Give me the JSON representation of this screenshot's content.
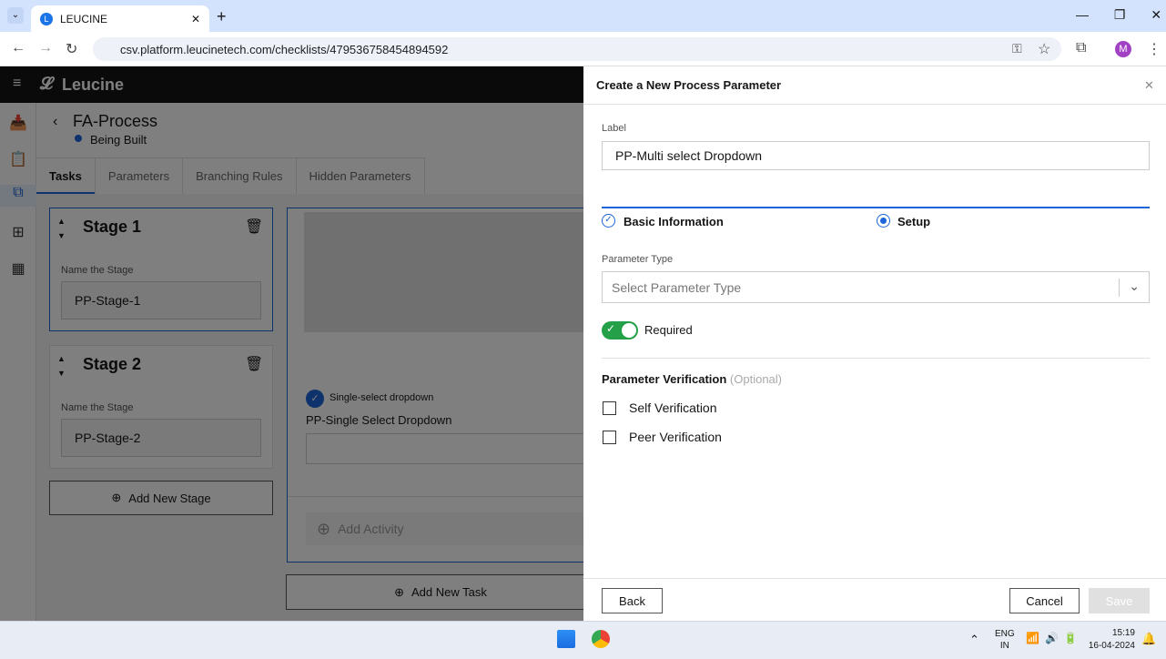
{
  "browser": {
    "tab_title": "LEUCINE",
    "url": "csv.platform.leucinetech.com/checklists/479536758454894592",
    "profile_initial": "M"
  },
  "app": {
    "brand": "Leucine",
    "process_title": "FA-Process",
    "status": "Being Built",
    "status_color": "#1d64d8",
    "tabs": [
      "Tasks",
      "Parameters",
      "Branching Rules",
      "Hidden Parameters"
    ],
    "stages": [
      {
        "title": "Stage 1",
        "name_label": "Name the Stage",
        "value": "PP-Stage-1"
      },
      {
        "title": "Stage 2",
        "name_label": "Name the Stage",
        "value": "PP-Stage-2"
      }
    ],
    "add_stage": "Add New Stage",
    "task": {
      "param_type": "Single-select dropdown",
      "param_label": "PP-Single Select Dropdown",
      "add_activity": "Add Activity",
      "add_task": "Add New Task"
    }
  },
  "panel": {
    "title": "Create a New Process Parameter",
    "label_caption": "Label",
    "label_value": "PP-Multi select Dropdown",
    "steps": [
      "Basic Information",
      "Setup"
    ],
    "param_type_caption": "Parameter Type",
    "param_type_placeholder": "Select Parameter Type",
    "required_label": "Required",
    "required_on": true,
    "verification_title": "Parameter Verification",
    "verification_optional": "(Optional)",
    "self_verification": "Self Verification",
    "peer_verification": "Peer Verification",
    "back": "Back",
    "cancel": "Cancel",
    "save": "Save",
    "accent": "#1d64d8",
    "toggle_color": "#24a148"
  },
  "taskbar": {
    "lang1": "ENG",
    "lang2": "IN",
    "time": "15:19",
    "date": "16-04-2024"
  }
}
